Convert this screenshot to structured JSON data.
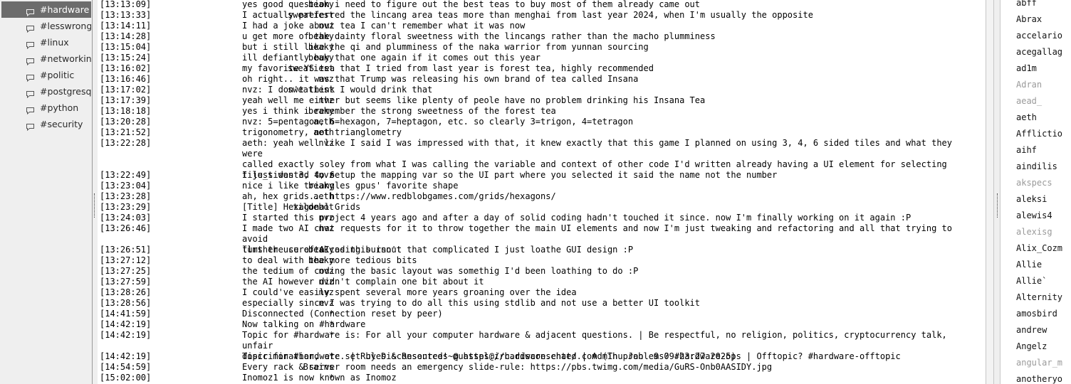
{
  "sidebar": {
    "channels": [
      {
        "label": "#hardware",
        "selected": true
      },
      {
        "label": "#lesswrong",
        "selected": false
      },
      {
        "label": "#linux",
        "selected": false
      },
      {
        "label": "#networking",
        "selected": false
      },
      {
        "label": "#politic",
        "selected": false
      },
      {
        "label": "#postgresql",
        "selected": false
      },
      {
        "label": "#python",
        "selected": false
      },
      {
        "label": "#security",
        "selected": false
      }
    ]
  },
  "chat": {
    "messages": [
      {
        "time": "[13:13:09]",
        "nick": "beaky",
        "text": "yes good question i need to figure out the best teas to buy most of them already came out"
      },
      {
        "time": "[13:13:33]",
        "nick": "sweatiest",
        "text": "I actually preferred the lincang area teas more than menghai from last year 2024, when I'm usually the opposite"
      },
      {
        "time": "[13:14:11]",
        "nick": "nvz",
        "text": "I had a joke about tea I can't remember what it was now"
      },
      {
        "time": "[13:14:28]",
        "nick": "beaky",
        "text": "u get more of the dainty floral sweetness with the lincangs rather than the macho plumminess"
      },
      {
        "time": "[13:15:04]",
        "nick": "beaky",
        "text": "but i still like the qi and plumminess of the naka warrior from yunnan sourcing"
      },
      {
        "time": "[13:15:24]",
        "nick": "beaky",
        "text": "ill defiantly buy that one again if it comes out this year"
      },
      {
        "time": "[13:16:02]",
        "nick": "sweatiest",
        "text": "my favorite YS tea that I tried from last year is forest tea, highly recommended"
      },
      {
        "time": "[13:16:46]",
        "nick": "nvz",
        "text": "oh right.. it was that Trump was releasing his own brand of tea called Insana"
      },
      {
        "time": "[13:17:02]",
        "nick": "sweatiest",
        "text": "nvz: I don't think I would drink that"
      },
      {
        "time": "[13:17:39]",
        "nick": "nvz",
        "text": "yeah well me either but seems like plenty of peole have no problem drinking his Insana Tea"
      },
      {
        "time": "[13:18:18]",
        "nick": "beaky",
        "text": "yes i think i remember the strong sweetness of the forest tea"
      },
      {
        "time": "[13:20:28]",
        "nick": "aeth",
        "text": "nvz: 5=pentagon, 6=hexagon, 7=heptagon, etc. so clearly 3=trigon, 4=tetragon"
      },
      {
        "time": "[13:21:52]",
        "nick": "aeth",
        "text": "trigonometry, not trianglometry"
      },
      {
        "time": "[13:22:28]",
        "nick": "nvz",
        "text": "aeth: yeah well like I said I was impressed with that, it knew exactly that this game I planned on using 3, 4, 6 sided tiles and what they were\ncalled exactly soley from what I was calling the variable and context of other code I'd written already having a UI element for selecting\ntile_sides 3, 4, 6"
      },
      {
        "time": "[13:22:49]",
        "nick": "nvz",
        "text": "I just wanted to setup the mapping var so the UI part where you selected it said the name not the number"
      },
      {
        "time": "[13:23:04]",
        "nick": "beaky",
        "text": "nice i like triangles gpus' favorite shape"
      },
      {
        "time": "[13:23:28]",
        "nick": "aeth",
        "text": "ah, hex grids... https://www.redblobgames.com/grids/hexagons/"
      },
      {
        "time": "[13:23:29]",
        "nick": "tildebot",
        "text": "[Title] Hexagonal Grids"
      },
      {
        "time": "[13:24:03]",
        "nick": "nvz",
        "text": "I started this project 4 years ago and after a day of solid coding hadn't touched it since. now I'm finally working on it again :P"
      },
      {
        "time": "[13:26:46]",
        "nick": "nvz",
        "text": "I made two AI chat requests for it to throw together the main UI elements and now I'm just tweaking and refactoring and all that trying to avoid\nfurther use of AI as this isn't that complicated I just loathe GUI design :P"
      },
      {
        "time": "[13:26:51]",
        "nick": "beaky",
        "text": "llms the cure to coding burnout"
      },
      {
        "time": "[13:27:12]",
        "nick": "beaky",
        "text": "to deal with the more tedious bits"
      },
      {
        "time": "[13:27:25]",
        "nick": "nvz",
        "text": "the tedium of coding the basic layout was somethig I'd been loathing to do :P"
      },
      {
        "time": "[13:27:59]",
        "nick": "nvz",
        "text": "the AI however didn't complain one bit about it"
      },
      {
        "time": "[13:28:26]",
        "nick": "nvz",
        "text": "I could've easily spent several more years groaning over the idea"
      },
      {
        "time": "[13:28:56]",
        "nick": "nvz",
        "text": "especially since I was trying to do all this using stdlib and not use a better UI toolkit"
      },
      {
        "time": "[14:41:59]",
        "nick": "*",
        "text": "Disconnected (Connection reset by peer)"
      },
      {
        "time": "[14:42:19]",
        "nick": "*",
        "text": "Now talking on #hardware"
      },
      {
        "time": "[14:42:19]",
        "nick": "*",
        "text": "Topic for #hardware is: For all your computer hardware & adjacent questions. | Be respectful, no religion, politics, cryptocurrency talk, unfair\ndiscrimination, etc. | Rules & Resources @ https://hardware.chat/ | Admin problems? #hardware-ops | Offtopic? #hardware-offtopic"
      },
      {
        "time": "[14:42:19]",
        "nick": "*",
        "text": "Topic for #hardware set by Disconsented!~quassel@irc.disconsented.com (Thu Jan  9 09:23:27 2025)"
      },
      {
        "time": "[14:54:59]",
        "nick": "Brains",
        "text": "Every rack & server room needs an emergency slide-rule: https://pbs.twimg.com/media/GuRS-Onb0AASIDY.jpg"
      },
      {
        "time": "[15:02:00]",
        "nick": "*",
        "text": "Inomoz1 is now known as Inomoz"
      }
    ]
  },
  "nicklist": {
    "nicks": [
      {
        "name": "abff",
        "away": false
      },
      {
        "name": "Abrax",
        "away": false
      },
      {
        "name": "accelario",
        "away": false
      },
      {
        "name": "acegallag",
        "away": false
      },
      {
        "name": "ad1m",
        "away": false
      },
      {
        "name": "Adran",
        "away": true
      },
      {
        "name": "aead_",
        "away": true
      },
      {
        "name": "aeth",
        "away": false
      },
      {
        "name": "Afflictio",
        "away": false
      },
      {
        "name": "aihf",
        "away": false
      },
      {
        "name": "aindilis",
        "away": false
      },
      {
        "name": "akspecs",
        "away": true
      },
      {
        "name": "aleksi",
        "away": false
      },
      {
        "name": "alewis4",
        "away": false
      },
      {
        "name": "alexisg",
        "away": true
      },
      {
        "name": "Alix_Cozm",
        "away": false
      },
      {
        "name": "Allie",
        "away": false
      },
      {
        "name": "Allie`",
        "away": false
      },
      {
        "name": "Alternity",
        "away": false
      },
      {
        "name": "amosbird",
        "away": false
      },
      {
        "name": "andrew",
        "away": false
      },
      {
        "name": "Angelz",
        "away": false
      },
      {
        "name": "angular_m",
        "away": true
      },
      {
        "name": "anotheryo",
        "away": false
      }
    ]
  },
  "colors": {
    "selected_channel_bg": "#6c6c6c",
    "away_nick": "#9a9a9a"
  }
}
